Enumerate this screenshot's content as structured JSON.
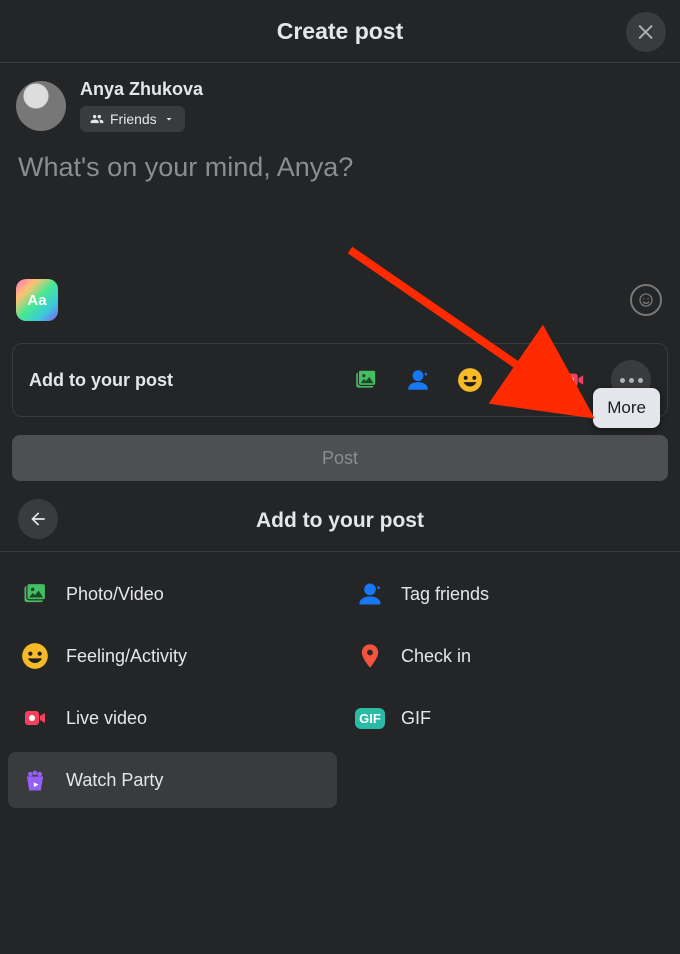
{
  "header": {
    "title": "Create post"
  },
  "user": {
    "name": "Anya Zhukova",
    "audience_label": "Friends"
  },
  "composer": {
    "placeholder": "What's on your mind, Anya?",
    "bg_button_text": "Aa"
  },
  "addto_bar": {
    "label": "Add to your post"
  },
  "tooltip": {
    "more_label": "More"
  },
  "post_button": {
    "label": "Post"
  },
  "panel": {
    "title": "Add to your post"
  },
  "options": {
    "photo_video": "Photo/Video",
    "tag_friends": "Tag friends",
    "feeling": "Feeling/Activity",
    "check_in": "Check in",
    "live_video": "Live video",
    "gif_badge": "GIF",
    "gif": "GIF",
    "watch_party": "Watch Party"
  },
  "colors": {
    "photo": "#45bd62",
    "tag": "#1877f2",
    "feeling": "#f7b928",
    "checkin": "#f5533d",
    "live": "#f3425f",
    "gif": "#2abba7",
    "watch": "#9360f7"
  }
}
